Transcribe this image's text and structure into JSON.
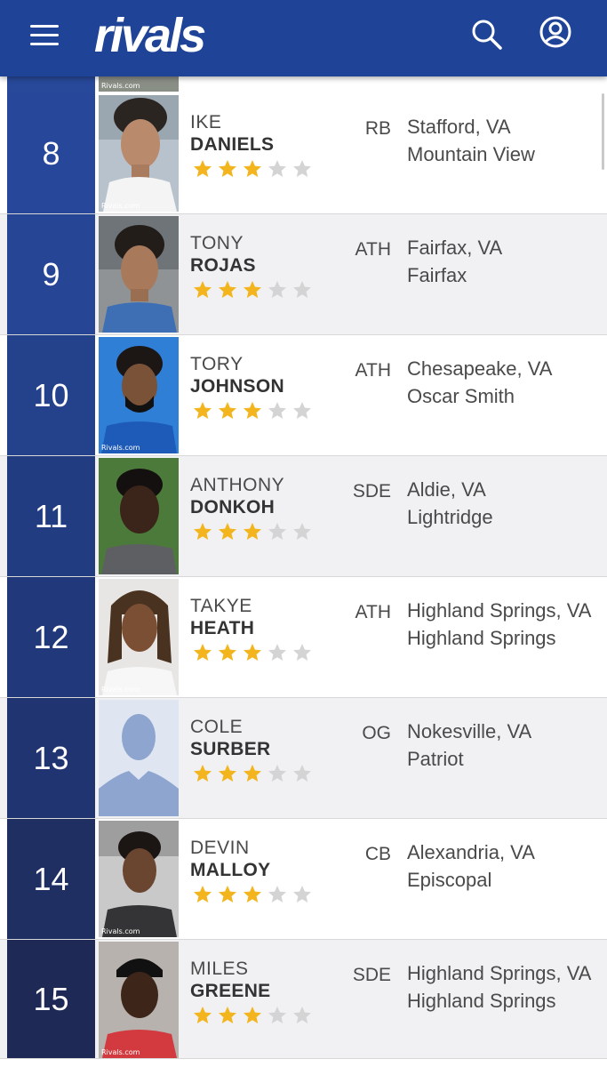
{
  "header": {
    "logo": "rivals",
    "menu_icon": "hamburger-menu-icon",
    "search_icon": "search-icon",
    "account_icon": "account-icon",
    "background_color": "#1f4497"
  },
  "watermark": "Rivals.com",
  "star_colors": {
    "filled": "#f2b51d",
    "empty": "#d4d4d4"
  },
  "players": [
    {
      "rank": "8",
      "first": "IKE",
      "last": "DANIELS",
      "stars": 3,
      "position": "RB",
      "hometown": "Stafford, VA",
      "school": "Mountain View"
    },
    {
      "rank": "9",
      "first": "TONY",
      "last": "ROJAS",
      "stars": 3,
      "position": "ATH",
      "hometown": "Fairfax, VA",
      "school": "Fairfax"
    },
    {
      "rank": "10",
      "first": "TORY",
      "last": "JOHNSON",
      "stars": 3,
      "position": "ATH",
      "hometown": "Chesapeake, VA",
      "school": "Oscar Smith"
    },
    {
      "rank": "11",
      "first": "ANTHONY",
      "last": "DONKOH",
      "stars": 3,
      "position": "SDE",
      "hometown": "Aldie, VA",
      "school": "Lightridge"
    },
    {
      "rank": "12",
      "first": "TAKYE",
      "last": "HEATH",
      "stars": 3,
      "position": "ATH",
      "hometown": "Highland Springs, VA",
      "school": "Highland Springs"
    },
    {
      "rank": "13",
      "first": "COLE",
      "last": "SURBER",
      "stars": 3,
      "position": "OG",
      "hometown": "Nokesville, VA",
      "school": "Patriot"
    },
    {
      "rank": "14",
      "first": "DEVIN",
      "last": "MALLOY",
      "stars": 3,
      "position": "CB",
      "hometown": "Alexandria, VA",
      "school": "Episcopal"
    },
    {
      "rank": "15",
      "first": "MILES",
      "last": "GREENE",
      "stars": 3,
      "position": "SDE",
      "hometown": "Highland Springs, VA",
      "school": "Highland Springs"
    }
  ]
}
